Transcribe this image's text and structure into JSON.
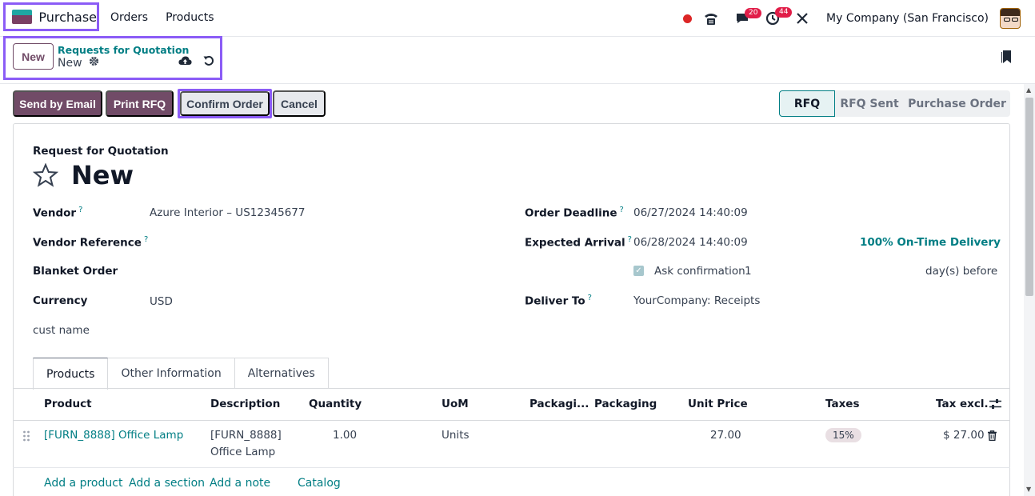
{
  "navbar": {
    "app_name": "Purchase",
    "menu": [
      "Orders",
      "Products"
    ],
    "messages_count": "20",
    "activities_count": "44",
    "company": "My Company (San Francisco)"
  },
  "control_panel": {
    "new_label": "New",
    "breadcrumb": "Requests for Quotation",
    "record_name": "New"
  },
  "actions": {
    "send_email": "Send by Email",
    "print_rfq": "Print RFQ",
    "confirm": "Confirm Order",
    "cancel": "Cancel"
  },
  "stages": [
    "RFQ",
    "RFQ Sent",
    "Purchase Order"
  ],
  "form": {
    "doc_type": "Request for Quotation",
    "title": "New",
    "vendor_label": "Vendor",
    "vendor_value": "Azure Interior – US12345677",
    "vendor_ref_label": "Vendor Reference",
    "blanket_label": "Blanket Order",
    "currency_label": "Currency",
    "currency_value": "USD",
    "cust_name_label": "cust name",
    "deadline_label": "Order Deadline",
    "deadline_value": "06/27/2024 14:40:09",
    "arrival_label": "Expected Arrival",
    "arrival_value": "06/28/2024 14:40:09",
    "ontime": "100% On-Time Delivery",
    "ask_confirmation": "Ask confirmation",
    "ask_days": "1",
    "days_before": "day(s) before",
    "deliver_label": "Deliver To",
    "deliver_value": "YourCompany: Receipts"
  },
  "tabs": [
    "Products",
    "Other Information",
    "Alternatives"
  ],
  "table": {
    "headers": {
      "product": "Product",
      "description": "Description",
      "quantity": "Quantity",
      "uom": "UoM",
      "packaging_qty": "Packagi...",
      "packaging": "Packaging",
      "unit_price": "Unit Price",
      "taxes": "Taxes",
      "tax_excl": "Tax excl."
    },
    "rows": [
      {
        "product": "[FURN_8888] Office Lamp",
        "description_l1": "[FURN_8888]",
        "description_l2": "Office Lamp",
        "quantity": "1.00",
        "uom": "Units",
        "unit_price": "27.00",
        "taxes": "15%",
        "subtotal": "$ 27.00"
      }
    ],
    "add_links": [
      "Add a product",
      "Add a section",
      "Add a note",
      "Catalog"
    ]
  },
  "colors": {
    "brand": "#714b67",
    "accent": "#017e84",
    "highlight": "#8b5cf6"
  }
}
